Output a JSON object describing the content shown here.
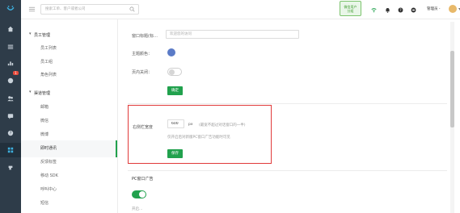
{
  "search": {
    "placeholder": "搜索工单、客户或者公司"
  },
  "header": {
    "promo_line1": "微信用户",
    "promo_line2": "分组",
    "admin_label": "管理员 -"
  },
  "rail": {
    "badge": "1",
    "icons": [
      "logo-icon",
      "home-icon",
      "list-icon",
      "chart-icon",
      "notification-icon",
      "users-icon",
      "message-icon",
      "help-icon",
      "apps-icon",
      "plugin-icon"
    ]
  },
  "submenu": {
    "groups": [
      {
        "label": "员工管理",
        "items": [
          "员工列表",
          "员工组",
          "角色列表"
        ]
      },
      {
        "label": "渠道管理",
        "items": [
          "邮箱",
          "微信",
          "微博",
          "即时通讯",
          "反馈标签",
          "移动 SDK",
          "呼叫中心",
          "短信"
        ]
      }
    ],
    "active_item": "即时通讯"
  },
  "form": {
    "window_title_label": "窗口标题(标…",
    "window_title_placeholder": "欢迎您的访问",
    "theme_color_label": "主题颜色：",
    "page_close_label": "页内关闭：",
    "confirm_label": "确定",
    "right_width_label": "右侧栏宽度",
    "right_width_value": "600",
    "right_width_unit": "px",
    "right_width_hint1": "(最宽不超过对话窗口的一半)",
    "right_width_hint2": "仅开启后对新版PC窗口广告功能时可见",
    "save_label": "保存",
    "pc_ad_title": "PC窗口广告",
    "cutoff_text": "开启…"
  },
  "colors": {
    "accent": "#21a14d",
    "rail": "#2e3c49",
    "theme_dot": "#5b7bc7",
    "highlight_box": "#e03a3a"
  }
}
